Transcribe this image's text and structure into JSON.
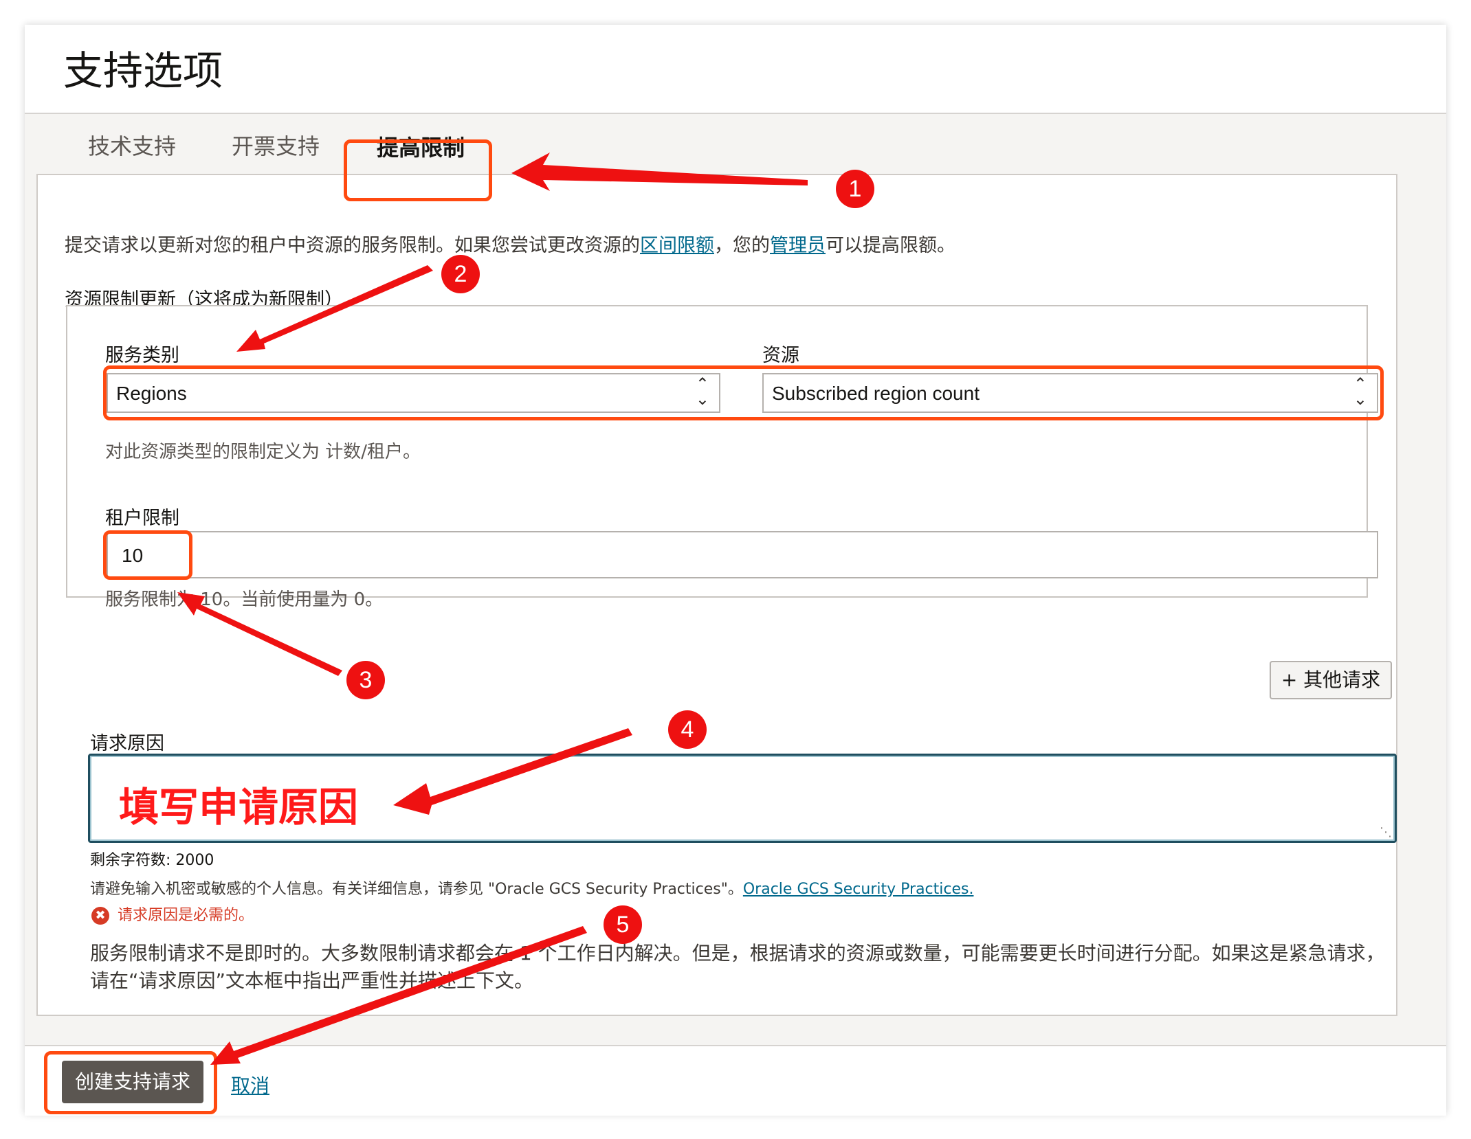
{
  "page_title": "支持选项",
  "tabs": [
    {
      "label": "技术支持"
    },
    {
      "label": "开票支持"
    },
    {
      "label": "提高限制"
    }
  ],
  "intro": {
    "text1": "提交请求以更新对您的租户中资源的服务限制。如果您尝试更改资源的",
    "link1": "区间限额",
    "text2": "，您的",
    "link2": "管理员",
    "text3": "可以提高限额。"
  },
  "section_label": "资源限制更新（这将成为新限制）",
  "service_category": {
    "label": "服务类别",
    "value": "Regions"
  },
  "resource": {
    "label": "资源",
    "value": "Subscribed region count"
  },
  "limit_definition": "对此资源类型的限制定义为 计数/租户。",
  "tenant_limit": {
    "label": "租户限制",
    "value": "10",
    "hint": "服务限制为 10。当前使用量为 0。"
  },
  "other_request_button": "+ 其他请求",
  "reason": {
    "label": "请求原因",
    "annotation": "填写申请原因",
    "chars_remaining": "剩余字符数: 2000",
    "privacy_text": "请避免输入机密或敏感的个人信息。有关详细信息，请参见 \"Oracle GCS Security Practices\"。",
    "privacy_link": "Oracle GCS Security Practices.",
    "error": "请求原因是必需的。"
  },
  "notice": "服务限制请求不是即时的。大多数限制请求都会在 1 个工作日内解决。但是，根据请求的资源或数量，可能需要更长时间进行分配。如果这是紧急请求，请在“请求原因”文本框中指出严重性并描述上下文。",
  "footer": {
    "create_button": "创建支持请求",
    "cancel_link": "取消"
  },
  "badges": [
    "1",
    "2",
    "3",
    "4",
    "5"
  ],
  "colors": {
    "highlight": "#ff4a10",
    "arrow": "#ee1111",
    "primary_button": "#5b5651",
    "link": "#00688c"
  }
}
